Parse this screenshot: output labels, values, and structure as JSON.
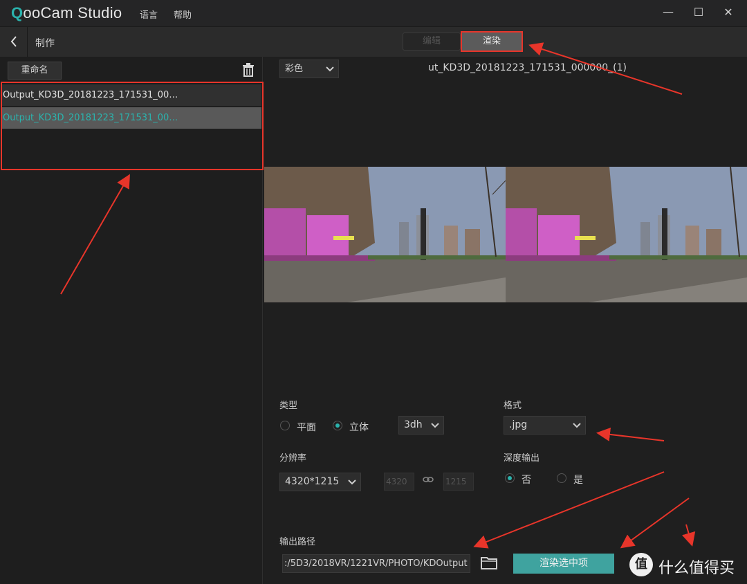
{
  "titlebar": {
    "app_logo": "QooCam Studio",
    "menu": [
      "语言",
      "帮助"
    ],
    "window_controls": {
      "minimize": "—",
      "maximize": "☐",
      "close": "✕"
    }
  },
  "subbar": {
    "back_icon": "chevron-left-icon",
    "breadcrumb": "制作",
    "tabs": [
      {
        "label": "编辑",
        "state": "disabled"
      },
      {
        "label": "渲染",
        "state": "active"
      }
    ]
  },
  "file_panel": {
    "rename_label": "重命名",
    "delete_icon": "trash-icon",
    "files": [
      {
        "name": "Output_KD3D_20181223_171531_00…",
        "selected": false
      },
      {
        "name": "Output_KD3D_20181223_171531_00…",
        "selected": true
      }
    ]
  },
  "preview": {
    "color_mode": "彩色",
    "file_title": "ut_KD3D_20181223_171531_000000_(1)"
  },
  "render_settings": {
    "type_label": "类型",
    "type_options": [
      {
        "label": "平面",
        "checked": false
      },
      {
        "label": "立体",
        "checked": true
      }
    ],
    "stereo_mode": "3dh",
    "format_label": "格式",
    "format_value": ".jpg",
    "resolution_label": "分辨率",
    "resolution_value": "4320*1215",
    "width_value": "4320",
    "height_value": "1215",
    "depth_label": "深度输出",
    "depth_options": [
      {
        "label": "否",
        "checked": true
      },
      {
        "label": "是",
        "checked": false
      }
    ],
    "output_path_label": "输出路径",
    "output_path_value": ":/5D3/2018VR/1221VR/PHOTO/KDOutput",
    "render_button": "渲染选中项"
  },
  "watermark": {
    "badge": "值",
    "text": "什么值得买"
  },
  "colors": {
    "accent": "#2bb3ad",
    "annotation_red": "#e8352a",
    "button_teal": "#3fa39f",
    "background": "#1e1e1e"
  }
}
